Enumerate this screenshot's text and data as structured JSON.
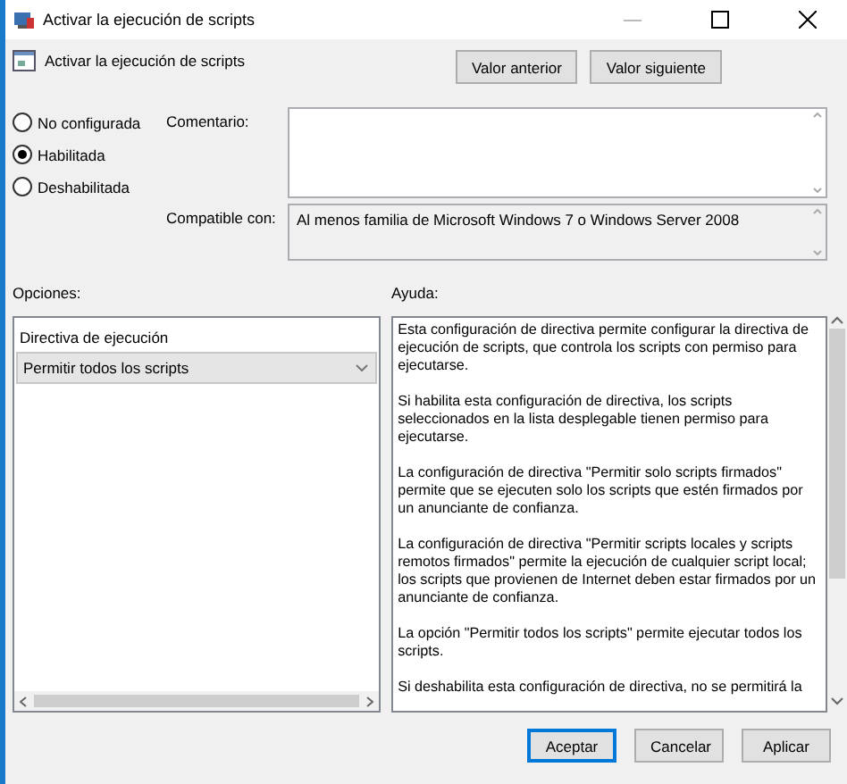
{
  "window": {
    "title": "Activar la ejecución de scripts"
  },
  "header": {
    "title": "Activar la ejecución de scripts",
    "buttons": [
      "Valor anterior",
      "Valor siguiente"
    ]
  },
  "states": [
    {
      "label": "No configurada",
      "selected": false
    },
    {
      "label": "Habilitada",
      "selected": true
    },
    {
      "label": "Deshabilitada",
      "selected": false
    }
  ],
  "comment": {
    "label": "Comentario:"
  },
  "compatible": {
    "label": "Compatible con:",
    "value": "Al menos familia de Microsoft Windows 7 o Windows Server 2008"
  },
  "options": {
    "label": "Opciones:",
    "setting": "Directiva de ejecución",
    "dropdown": "Permitir todos los scripts"
  },
  "help": {
    "label": "Ayuda:",
    "paragraphs": [
      "Esta configuración de directiva permite configurar la directiva de\nejecución de scripts, que controla los scripts con permiso para\nejecutarse.",
      "Si habilita esta configuración de directiva, los scripts\nseleccionados en la lista desplegable tienen permiso para\nejecutarse.",
      "La configuración de directiva \"Permitir solo scripts firmados\"\npermite que se ejecuten solo los scripts que estén firmados por\nun anunciante de confianza.",
      "La configuración de directiva \"Permitir scripts locales y scripts\nremotos firmados\" permite la ejecución de cualquier script local;\nlos scripts que provienen de Internet deben estar firmados por un\nanunciante de confianza.",
      "La opción \"Permitir todos los scripts\" permite ejecutar todos los\nscripts.",
      "Si deshabilita esta configuración de directiva, no se permitirá la"
    ]
  },
  "buttons": [
    {
      "label": "Aceptar",
      "default": true
    },
    {
      "label": "Cancelar",
      "default": false
    },
    {
      "label": "Aplicar",
      "default": false
    }
  ]
}
